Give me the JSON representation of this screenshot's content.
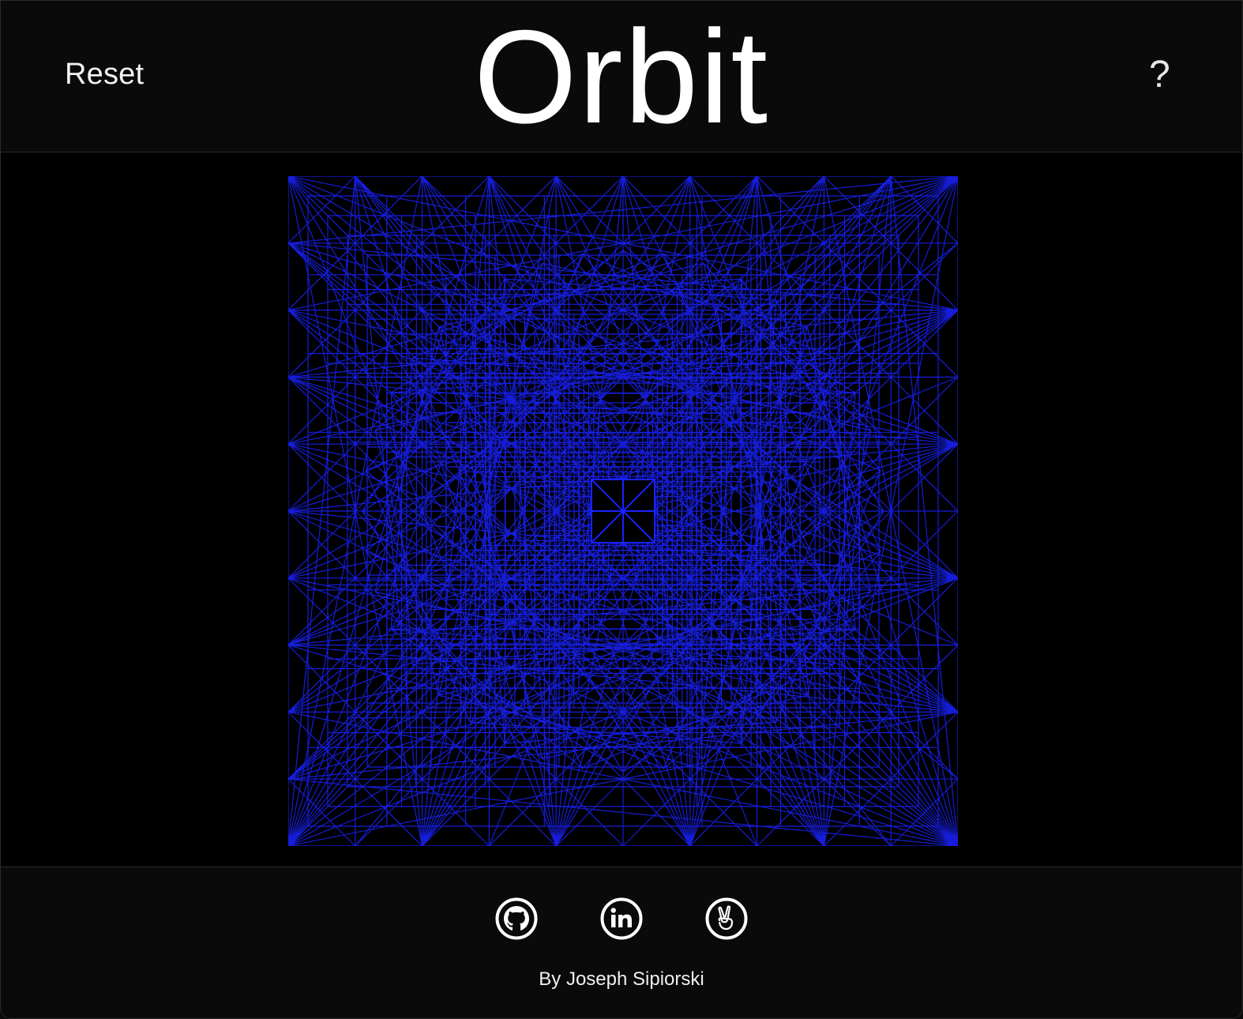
{
  "header": {
    "reset_label": "Reset",
    "title": "Orbit",
    "help_label": "?"
  },
  "visualization": {
    "type": "wireframe-pattern",
    "line_color": "#1a22ff",
    "background_color": "#000000"
  },
  "footer": {
    "links": [
      {
        "name": "github",
        "icon": "github-icon"
      },
      {
        "name": "linkedin",
        "icon": "linkedin-icon"
      },
      {
        "name": "angellist",
        "icon": "angellist-icon"
      }
    ],
    "credit": "By Joseph Sipiorski"
  },
  "colors": {
    "page_background": "#0a0a0a",
    "canvas_background": "#000000",
    "text": "#ffffff",
    "accent": "#1a22ff"
  }
}
